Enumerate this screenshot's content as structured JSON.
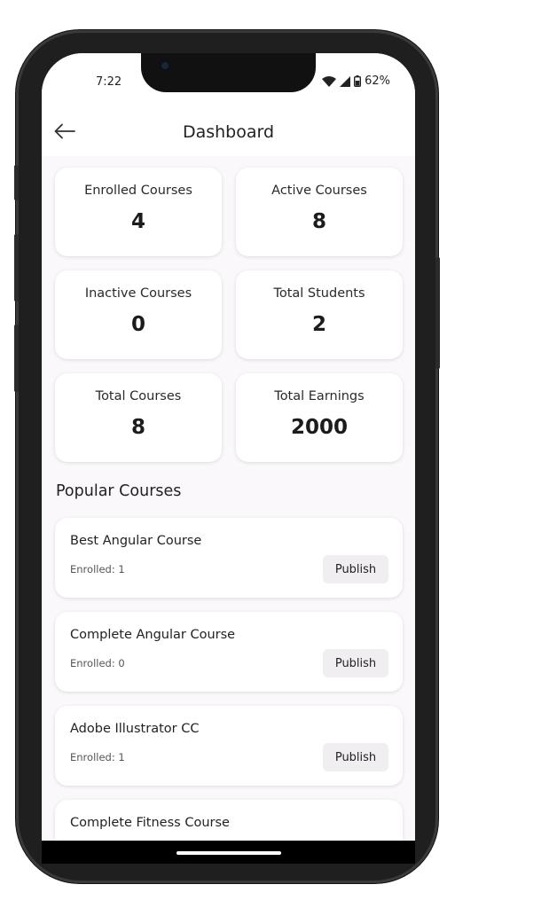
{
  "status_bar": {
    "time": "7:22",
    "battery": "62%",
    "icons": [
      "wifi-icon",
      "cellular-signal-icon",
      "battery-icon"
    ]
  },
  "header": {
    "title": "Dashboard",
    "back_icon": "arrow-left-icon"
  },
  "stats": [
    {
      "label": "Enrolled Courses",
      "value": "4"
    },
    {
      "label": "Active Courses",
      "value": "8"
    },
    {
      "label": "Inactive Courses",
      "value": "0"
    },
    {
      "label": "Total Students",
      "value": "2"
    },
    {
      "label": "Total Courses",
      "value": "8"
    },
    {
      "label": "Total Earnings",
      "value": "2000"
    }
  ],
  "popular": {
    "title": "Popular Courses",
    "courses": [
      {
        "title": "Best Angular Course",
        "enrolled": "Enrolled: 1",
        "action": "Publish"
      },
      {
        "title": "Complete Angular Course",
        "enrolled": "Enrolled: 0",
        "action": "Publish"
      },
      {
        "title": "Adobe Illustrator CC",
        "enrolled": "Enrolled: 1",
        "action": "Publish"
      },
      {
        "title": "Complete Fitness Course",
        "enrolled": "",
        "action": ""
      }
    ]
  },
  "colors": {
    "screen_background": "#faf8fa",
    "card_background": "#ffffff",
    "button_background": "#f0eef0",
    "text": "#222222"
  }
}
